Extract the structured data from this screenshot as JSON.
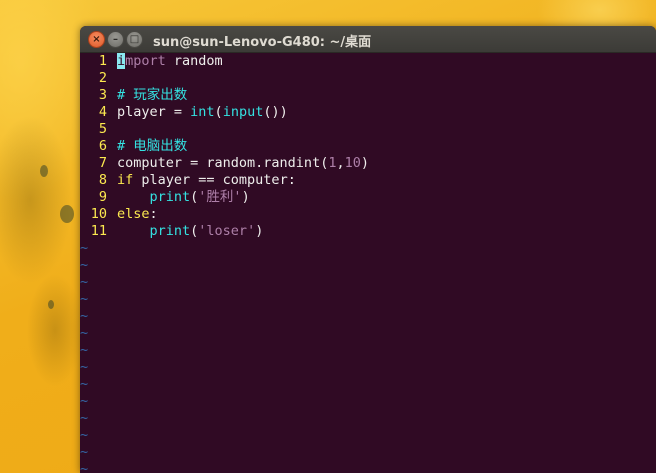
{
  "window": {
    "title": "sun@sun-Lenovo-G480: ~/桌面",
    "buttons": {
      "close": "×",
      "minimize": "–",
      "maximize": "□"
    }
  },
  "editor": {
    "lines": [
      {
        "num": "1",
        "tokens": [
          {
            "t": "i",
            "c": "cursor"
          },
          {
            "t": "mport",
            "c": "kw-import"
          },
          {
            "t": " random",
            "c": ""
          }
        ]
      },
      {
        "num": "2",
        "tokens": []
      },
      {
        "num": "3",
        "tokens": [
          {
            "t": "# 玩家出数",
            "c": "cm"
          }
        ]
      },
      {
        "num": "4",
        "tokens": [
          {
            "t": "player = ",
            "c": ""
          },
          {
            "t": "int",
            "c": "fn"
          },
          {
            "t": "(",
            "c": ""
          },
          {
            "t": "input",
            "c": "fn"
          },
          {
            "t": "())",
            "c": ""
          }
        ]
      },
      {
        "num": "5",
        "tokens": []
      },
      {
        "num": "6",
        "tokens": [
          {
            "t": "# 电脑出数",
            "c": "cm"
          }
        ]
      },
      {
        "num": "7",
        "tokens": [
          {
            "t": "computer = random.randint(",
            "c": ""
          },
          {
            "t": "1",
            "c": "num"
          },
          {
            "t": ",",
            "c": ""
          },
          {
            "t": "10",
            "c": "num"
          },
          {
            "t": ")",
            "c": ""
          }
        ]
      },
      {
        "num": "8",
        "tokens": [
          {
            "t": "if",
            "c": "kw"
          },
          {
            "t": " player == computer:",
            "c": ""
          }
        ]
      },
      {
        "num": "9",
        "tokens": [
          {
            "t": "    ",
            "c": ""
          },
          {
            "t": "print",
            "c": "fn"
          },
          {
            "t": "(",
            "c": ""
          },
          {
            "t": "'胜利'",
            "c": "str"
          },
          {
            "t": ")",
            "c": ""
          }
        ]
      },
      {
        "num": "10",
        "tokens": [
          {
            "t": "else",
            "c": "kw"
          },
          {
            "t": ":",
            "c": ""
          }
        ]
      },
      {
        "num": "11",
        "tokens": [
          {
            "t": "    ",
            "c": ""
          },
          {
            "t": "print",
            "c": "fn"
          },
          {
            "t": "(",
            "c": ""
          },
          {
            "t": "'loser'",
            "c": "str"
          },
          {
            "t": ")",
            "c": ""
          }
        ]
      }
    ],
    "empty_line_marker": "~",
    "empty_line_count": 14
  },
  "colors": {
    "terminal_bg": "#300a24",
    "line_number": "#fce94f",
    "keyword": "#fce94f",
    "builtin": "#34e2e2",
    "comment": "#34e2e2",
    "string": "#ad7fa8",
    "tilde": "#3465a4",
    "desktop": "#f2b21c"
  }
}
